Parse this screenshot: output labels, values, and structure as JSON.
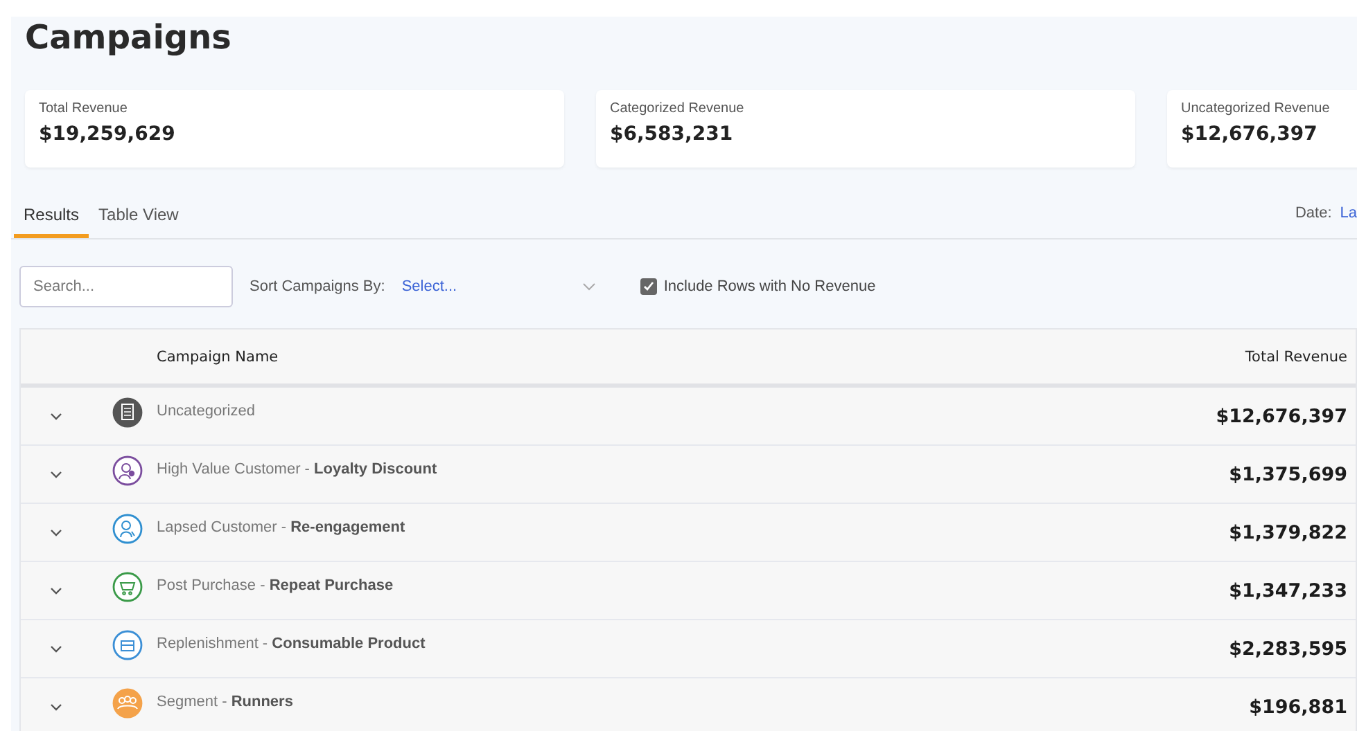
{
  "title": "Campaigns",
  "summary_cards": [
    {
      "label": "Total Revenue",
      "value": "$19,259,629"
    },
    {
      "label": "Categorized Revenue",
      "value": "$6,583,231"
    },
    {
      "label": "Uncategorized Revenue",
      "value": "$12,676,397"
    }
  ],
  "tabs": [
    {
      "label": "Results",
      "selected": true
    },
    {
      "label": "Table View",
      "selected": false
    }
  ],
  "date": {
    "label": "Date:",
    "value": "La"
  },
  "search": {
    "placeholder": "Search..."
  },
  "sort": {
    "label": "Sort Campaigns By:",
    "value": "Select..."
  },
  "include_no_revenue": {
    "label": "Include Rows with No Revenue",
    "checked": true
  },
  "table": {
    "columns": [
      "Campaign Name",
      "Total Revenue"
    ],
    "rows": [
      {
        "kind": "document",
        "color": "#555555",
        "name": "Uncategorized",
        "revenue": "$12,676,397"
      },
      {
        "kind": "person-badge",
        "color": "#7b4d9e",
        "name": "High Value Customer - **Loyalty Discount**",
        "revenue": "$1,375,699"
      },
      {
        "kind": "person",
        "color": "#2f8fd0",
        "name": "Lapsed Customer - **Re-engagement**",
        "revenue": "$1,379,822"
      },
      {
        "kind": "cart",
        "color": "#3a9a48",
        "name": "Post Purchase - **Repeat Purchase**",
        "revenue": "$1,347,233"
      },
      {
        "kind": "box",
        "color": "#3b8fd6",
        "name": "Replenishment - **Consumable Product**",
        "revenue": "$2,283,595"
      },
      {
        "kind": "group",
        "color": "#f4a24a",
        "name": "Segment - **Runners**",
        "revenue": "$196,881"
      }
    ]
  }
}
